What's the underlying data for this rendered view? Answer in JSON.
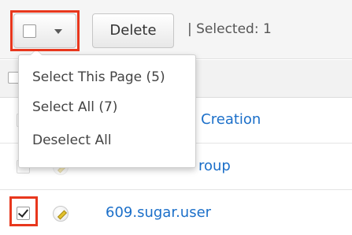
{
  "toolbar": {
    "delete_label": "Delete",
    "selected_label": "| Selected:  1"
  },
  "dropdown": {
    "items": [
      {
        "label": "Select This Page (5)"
      },
      {
        "label": "Select All (7)"
      },
      {
        "label": "Deselect All"
      }
    ]
  },
  "rows": [
    {
      "name": "se Creation",
      "checked": false
    },
    {
      "name": "roup",
      "checked": false
    },
    {
      "name": "609.sugar.user",
      "checked": true
    }
  ],
  "colors": {
    "highlight": "#e8371d",
    "link": "#1b6fc9"
  },
  "icons": [
    "chevron-down-icon",
    "pencil-edit-icon",
    "checkbox-icon"
  ]
}
